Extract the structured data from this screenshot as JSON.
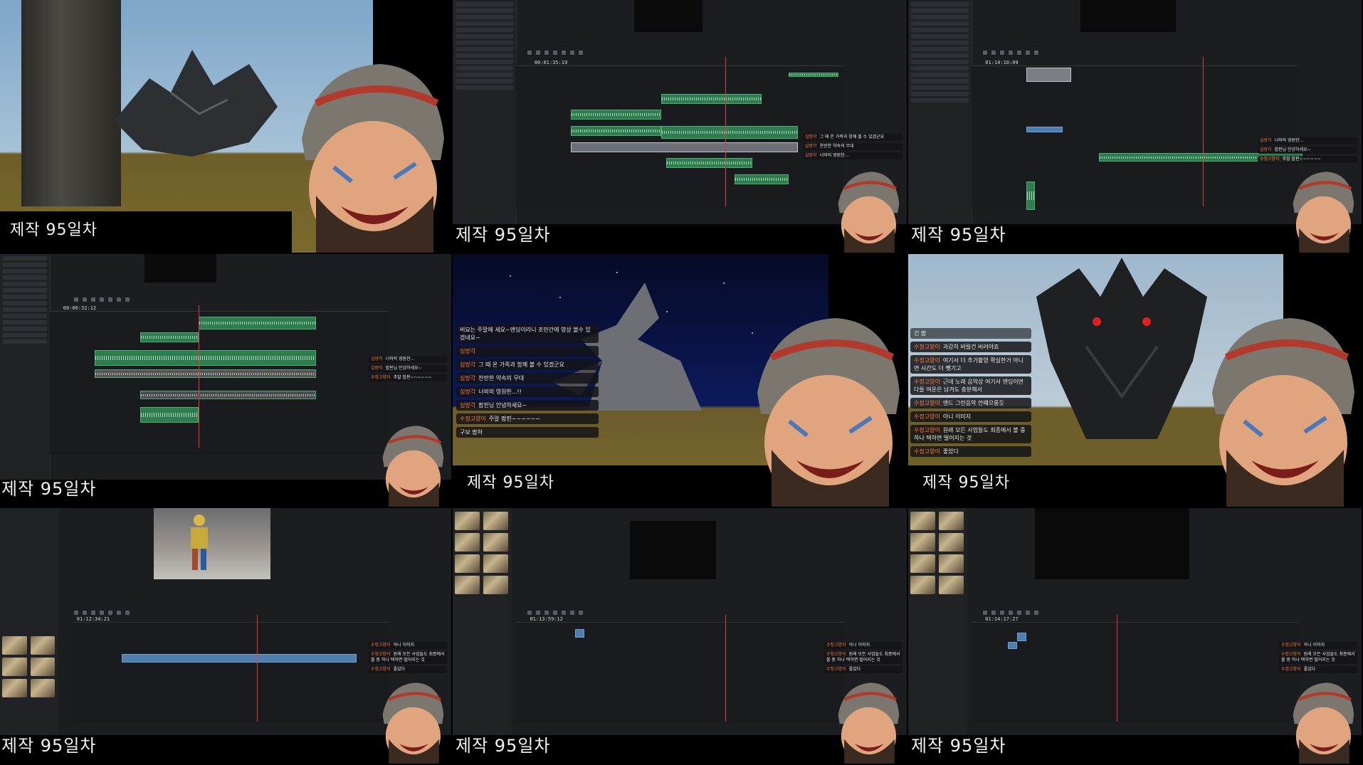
{
  "caption": "제작 95일차",
  "timecodes": {
    "t2": "00:01:35:19",
    "t3": "01:14:10:09",
    "t4": "00:00:32:12",
    "t7": "01:12:34:21",
    "t8": "01:13:59:12",
    "t9": "01:14:17:27"
  },
  "chat_stream": {
    "header": "",
    "messages": [
      {
        "nick": "",
        "text": "버묘는 주말에 새요~앤딩이라니 조만간에 영상 볼수 있겠네요~"
      },
      {
        "nick": "심방각",
        "text": ""
      },
      {
        "nick": "심방각",
        "text": "그 때 온 가족과 함께 볼 수 있겠군요"
      },
      {
        "nick": "심방각",
        "text": "찬란한 약속의 무대"
      },
      {
        "nick": "심방각",
        "text": "너와의 영원한...!!"
      },
      {
        "nick": "심방각",
        "text": "팝핀님 안녕하세요~"
      },
      {
        "nick": "수정고양이",
        "text": "주말 팝핀~~~~~~"
      },
      {
        "nick": "",
        "text": "구보 팝하"
      }
    ]
  },
  "chat_dragon": {
    "header": "긴 팝",
    "messages": [
      {
        "nick": "수정고양이",
        "text": "과감히 버릴건 버려야죠"
      },
      {
        "nick": "수정고양이",
        "text": "여기서 더 추가촬영 확실한거 아니면 시간도 더 뺏기고"
      },
      {
        "nick": "수정고양이",
        "text": "근데 노래 음악상 여기서 엔딩이면 다들 여운은 남겨도 충분해서"
      },
      {
        "nick": "수정고양이",
        "text": "엔드 그런음악 안떄으롱듯"
      },
      {
        "nick": "수정고양이",
        "text": "아니 이미지"
      },
      {
        "nick": "수정고양이",
        "text": "원래 모든 사업들도 최종에서 볼 중 하나 텍하면 떨어지는 것"
      },
      {
        "nick": "수정고양이",
        "text": "좋았다"
      }
    ]
  },
  "mini_chat_a": [
    {
      "nick": "심방각",
      "text": "그 때 온 가족과 함께 볼 수 있겠군요"
    },
    {
      "nick": "심방각",
      "text": "찬란한 약속의 무대"
    },
    {
      "nick": "심방각",
      "text": "너와의 영원한..."
    }
  ],
  "mini_chat_b": [
    {
      "nick": "심방각",
      "text": "너와의 영원한..."
    },
    {
      "nick": "심방각",
      "text": "팝핀님 안녕하세요~"
    },
    {
      "nick": "수정고양이",
      "text": "주말 팝핀~~~~~~"
    }
  ],
  "mini_chat_c": [
    {
      "nick": "수정고양이",
      "text": "아니 이미지"
    },
    {
      "nick": "수정고양이",
      "text": "원래 모든 사업들도 최종에서 볼 중 하나 텍하면 떨어지는 것"
    },
    {
      "nick": "수정고양이",
      "text": "좋았다"
    }
  ],
  "colors": {
    "accent_red": "#e23a3a",
    "audio_green": "#2d7d4e",
    "nick_orange": "#ff7a3c"
  },
  "icons": [
    "knight-avatar-icon",
    "dragon-icon",
    "play-icon",
    "stop-icon"
  ]
}
